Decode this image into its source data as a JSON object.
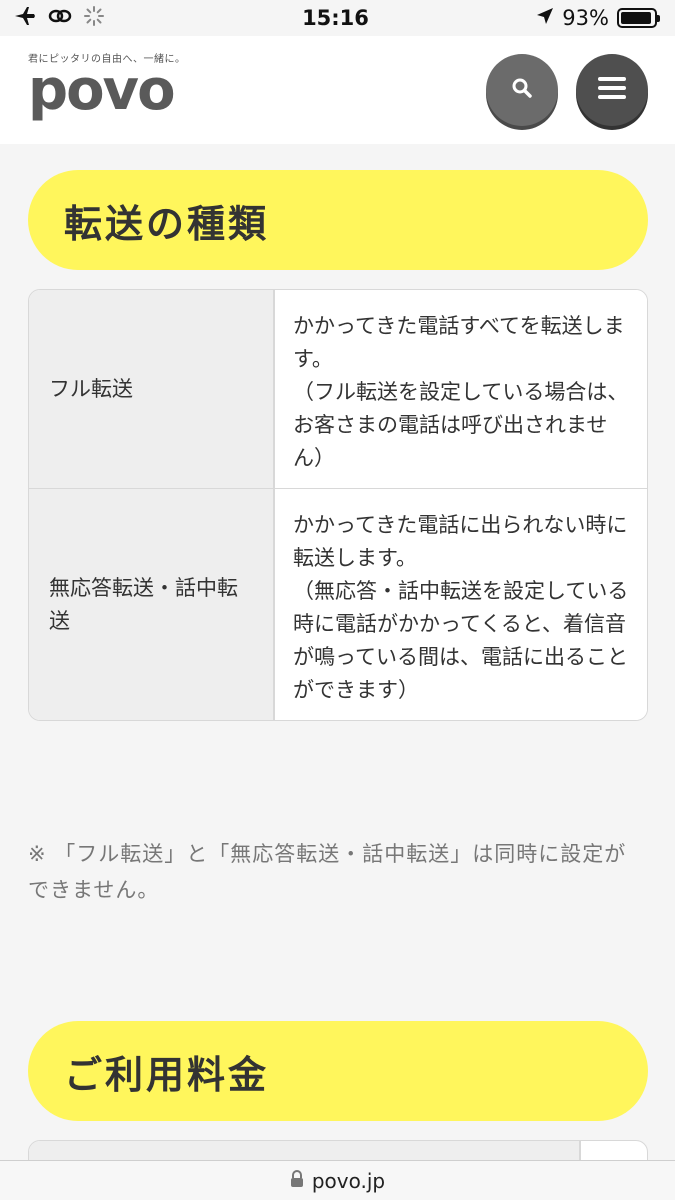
{
  "status_bar": {
    "time": "15:16",
    "battery_percent": "93%",
    "battery_level": 0.93,
    "icons": [
      "airplane-icon",
      "link-icon",
      "loading-icon",
      "location-arrow-icon",
      "battery-icon"
    ]
  },
  "header": {
    "tagline": "君にピッタリの自由へ、一緒に。",
    "logo_text": "povo",
    "search_icon": "search-icon",
    "menu_icon": "hamburger-menu-icon"
  },
  "sections": {
    "transfer_types": {
      "title": "転送の種類",
      "rows": [
        {
          "label": "フル転送",
          "description": "かかってきた電話すべてを転送します。\n（フル転送を設定している場合は、お客さまの電話は呼び出されません）"
        },
        {
          "label": "無応答転送・話中転送",
          "description": "かかってきた電話に出られない時に転送します。\n（無応答・話中転送を設定している時に電話がかかってくると、着信音が鳴っている間は、電話に出ることができます）"
        }
      ],
      "note": "※ 「フル転送」と「無応答転送・話中転送」は同時に設定ができません。"
    },
    "fees": {
      "title": "ご利用料金"
    }
  },
  "browser": {
    "url": "povo.jp",
    "lock_icon": "lock-icon"
  },
  "colors": {
    "accent_yellow": "#fff65c",
    "header_bg": "#ffffff",
    "page_bg": "#f5f5f5"
  }
}
